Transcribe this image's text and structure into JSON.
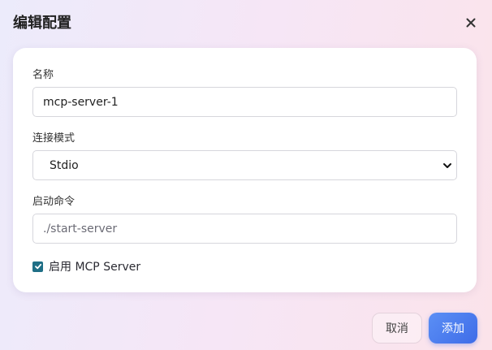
{
  "dialog": {
    "title": "编辑配置",
    "close_icon": "close-icon"
  },
  "form": {
    "name": {
      "label": "名称",
      "value": "mcp-server-1"
    },
    "mode": {
      "label": "连接模式",
      "selected": "Stdio",
      "icon": "chevron-down-icon"
    },
    "command": {
      "label": "启动命令",
      "placeholder": "./start-server"
    },
    "enable": {
      "label": "启用 MCP Server",
      "checked": true
    }
  },
  "actions": {
    "cancel_label": "取消",
    "add_label": "添加"
  },
  "colors": {
    "accent": "#3e6ce8",
    "checkbox": "#1f6f86"
  }
}
